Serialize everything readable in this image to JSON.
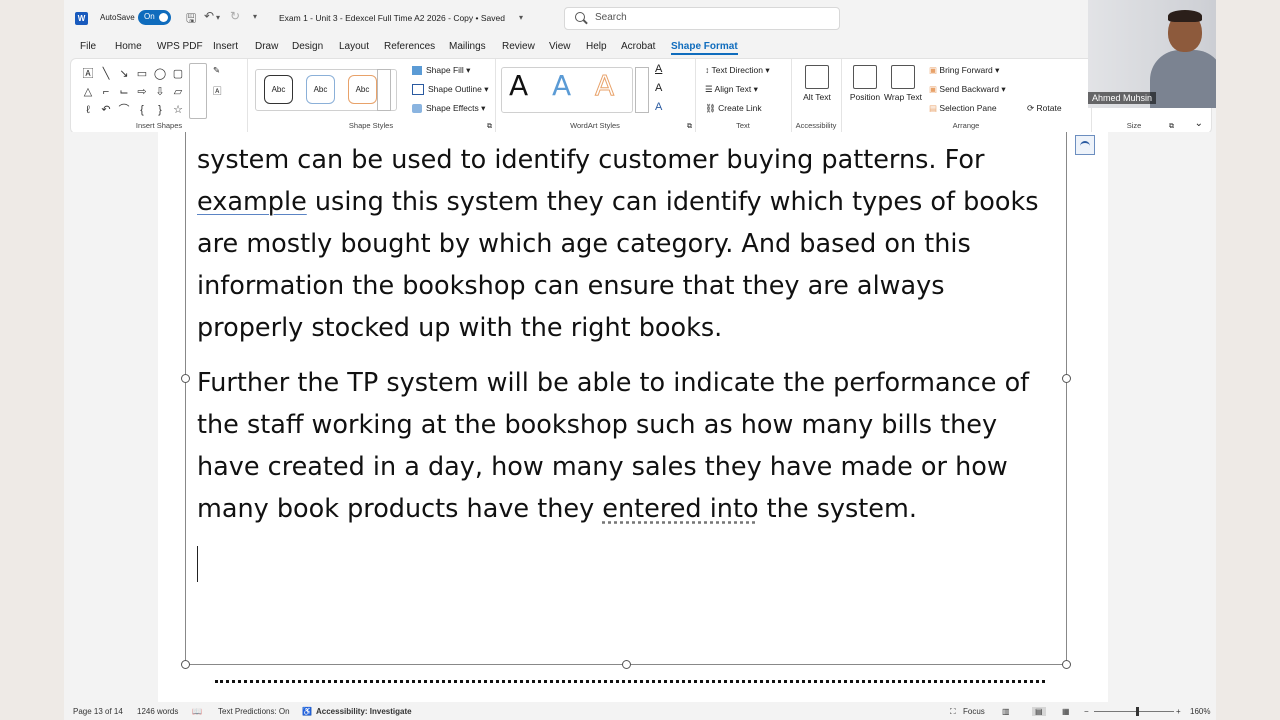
{
  "titlebar": {
    "autosave_label": "AutoSave",
    "autosave_state": "On",
    "document_title": "Exam 1 - Unit 3 - Edexcel Full Time A2 2026 - Copy • Saved",
    "search_placeholder": "Search"
  },
  "menu": [
    "File",
    "Home",
    "WPS PDF",
    "Insert",
    "Draw",
    "Design",
    "Layout",
    "References",
    "Mailings",
    "Review",
    "View",
    "Help",
    "Acrobat",
    "Shape Format"
  ],
  "ribbon": {
    "insert_shapes_label": "Insert Shapes",
    "shape_styles": {
      "samples": [
        "Abc",
        "Abc",
        "Abc"
      ],
      "fill": "Shape Fill",
      "outline": "Shape Outline",
      "effects": "Shape Effects",
      "label": "Shape Styles"
    },
    "wordart": {
      "sample": "A",
      "label": "WordArt Styles"
    },
    "text": {
      "direction": "Text Direction",
      "align": "Align Text",
      "link": "Create Link",
      "label": "Text"
    },
    "accessibility": {
      "alt_text": "Alt Text",
      "label": "Accessibility"
    },
    "arrange": {
      "position": "Position",
      "wrap": "Wrap Text",
      "bring_forward": "Bring Forward",
      "send_backward": "Send Backward",
      "selection_pane": "Selection Pane",
      "rotate": "Rotate",
      "label": "Arrange"
    },
    "size_label": "Size"
  },
  "webcam": {
    "name": "Ahmed Muhsin"
  },
  "document": {
    "para1": [
      "system can be used to identify customer buying patterns. For",
      "example",
      " using this system they can identify which types of books",
      "are mostly bought by which age category. And based on this",
      "information the bookshop can ensure that they are always",
      "properly stocked up with the right books."
    ],
    "para2": [
      "Further the TP system will be able to indicate the performance of",
      "the staff working at the bookshop such as how many bills they",
      "have created in a day, how many sales they have made or how",
      "many book products have they ",
      "entered into",
      " the system."
    ]
  },
  "status": {
    "page": "Page 13 of 14",
    "words": "1246 words",
    "predictions": "Text Predictions: On",
    "accessibility": "Accessibility: Investigate",
    "focus": "Focus",
    "zoom": "160%"
  },
  "colors": {
    "accent": "#0f6cbd"
  }
}
